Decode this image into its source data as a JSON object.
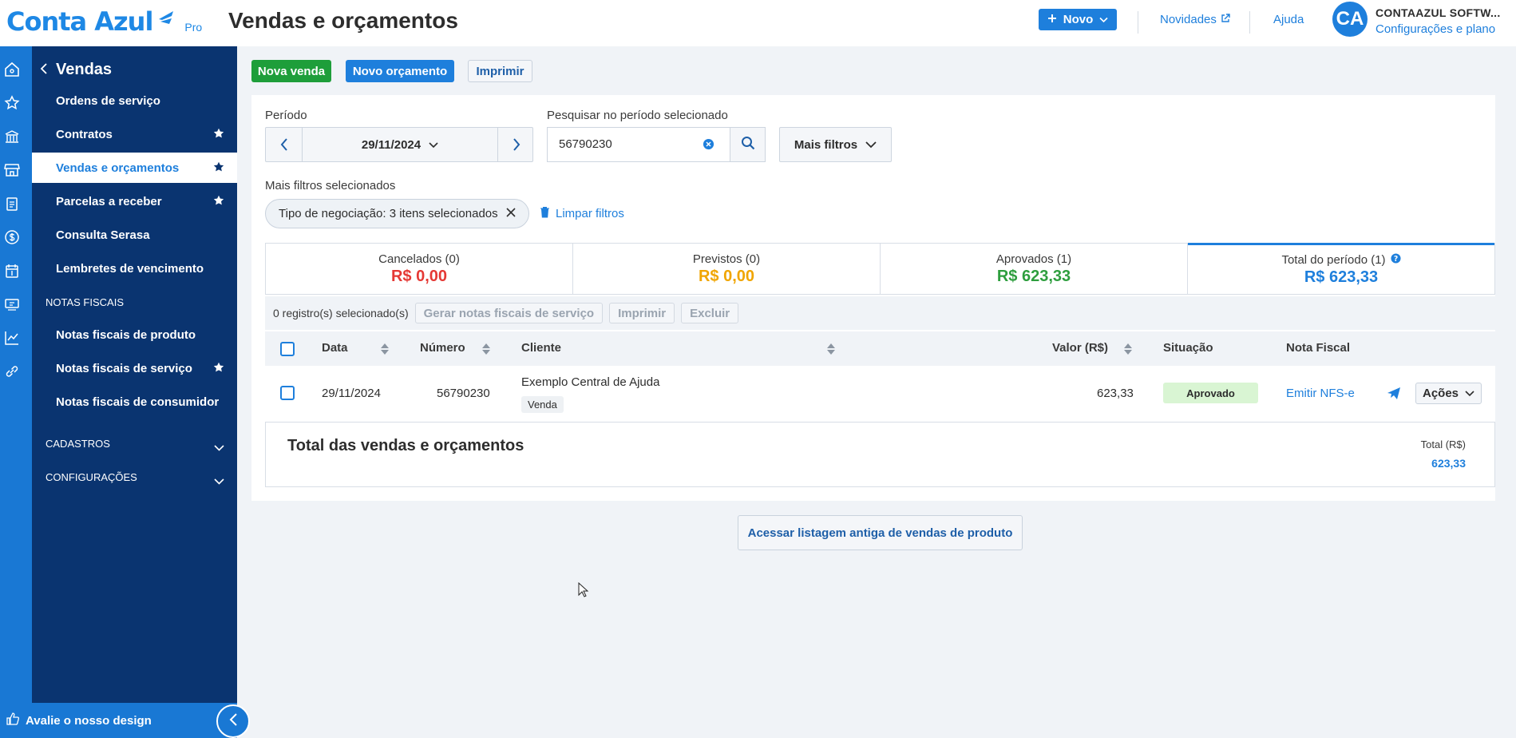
{
  "app": {
    "brand": "Conta Azul",
    "plan": "Pro",
    "page_title": "Vendas e orçamentos",
    "novo_label": "Novo",
    "novidades_label": "Novidades",
    "ajuda_label": "Ajuda",
    "avatar_initials": "CA",
    "company_name": "CONTAAZUL SOFTW...",
    "company_link": "Configurações e plano"
  },
  "rail_icons": [
    "home-icon",
    "star-icon",
    "bank-icon",
    "store-icon",
    "clipboard-icon",
    "money-icon",
    "calendar-money-icon",
    "register-icon",
    "chart-icon",
    "link-icon"
  ],
  "sidebar": {
    "back_title": "Vendas",
    "items": [
      {
        "label": "Ordens de serviço",
        "star": false,
        "active": false
      },
      {
        "label": "Contratos",
        "star": true,
        "active": false
      },
      {
        "label": "Vendas e orçamentos",
        "star": true,
        "active": true
      },
      {
        "label": "Parcelas a receber",
        "star": true,
        "active": false
      },
      {
        "label": "Consulta Serasa",
        "star": false,
        "active": false
      },
      {
        "label": "Lembretes de vencimento",
        "star": false,
        "active": false
      }
    ],
    "section_notas": "NOTAS FISCAIS",
    "notas_items": [
      {
        "label": "Notas fiscais de produto",
        "star": false
      },
      {
        "label": "Notas fiscais de serviço",
        "star": true
      },
      {
        "label": "Notas fiscais de consumidor",
        "star": false
      }
    ],
    "section_cadastros": "CADASTROS",
    "section_config": "CONFIGURAÇÕES",
    "feedback_label": "Avalie o nosso design"
  },
  "actions": {
    "nova_venda": "Nova venda",
    "novo_orcamento": "Novo orçamento",
    "imprimir": "Imprimir"
  },
  "filters": {
    "periodo_label": "Período",
    "periodo_value": "29/11/2024",
    "search_label": "Pesquisar no período selecionado",
    "search_value": "56790230",
    "mais_filtros": "Mais filtros",
    "selected_label": "Mais filtros selecionados",
    "chip": "Tipo de negociação: 3 itens selecionados",
    "limpar": "Limpar filtros"
  },
  "summary": [
    {
      "label": "Cancelados (0)",
      "value": "R$ 0,00",
      "color": "#e53935"
    },
    {
      "label": "Previstos (0)",
      "value": "R$ 0,00",
      "color": "#f0a500"
    },
    {
      "label": "Aprovados (1)",
      "value": "R$ 623,33",
      "color": "#2e9e3e"
    },
    {
      "label": "Total do período (1)",
      "value": "R$ 623,33",
      "color": "#1e7fdc"
    }
  ],
  "bulk": {
    "selected_text": "0 registro(s) selecionado(s)",
    "gerar": "Gerar notas fiscais de serviço",
    "imprimir": "Imprimir",
    "excluir": "Excluir"
  },
  "table": {
    "headers": {
      "data": "Data",
      "numero": "Número",
      "cliente": "Cliente",
      "valor": "Valor (R$)",
      "situacao": "Situação",
      "nota": "Nota Fiscal"
    },
    "rows": [
      {
        "data": "29/11/2024",
        "numero": "56790230",
        "cliente": "Exemplo Central de Ajuda",
        "tipo": "Venda",
        "valor": "623,33",
        "situacao": "Aprovado",
        "nota": "Emitir NFS-e",
        "acoes": "Ações"
      }
    ]
  },
  "total": {
    "title": "Total das vendas e orçamentos",
    "label": "Total (R$)",
    "value": "623,33"
  },
  "old_list_button": "Acessar listagem antiga de vendas de produto",
  "colors": {
    "brand": "#1e88e5",
    "sidebar": "#0a3470",
    "rail": "#1978d4",
    "green": "#1e9e3a"
  }
}
